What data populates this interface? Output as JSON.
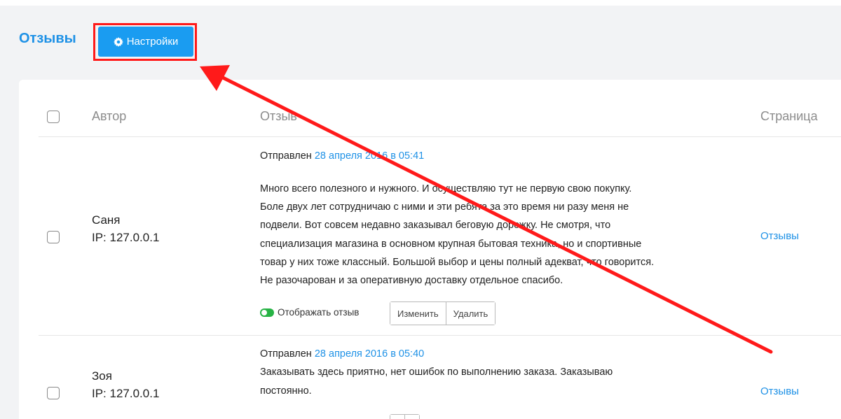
{
  "header": {
    "title": "Отзывы",
    "settings_label": "Настройки"
  },
  "table": {
    "columns": [
      "Автор",
      "Отзыв",
      "Страница"
    ]
  },
  "reviews": [
    {
      "author": "Саня",
      "ip": "IP: 127.0.0.1",
      "sent_label": "Отправлен",
      "date": "28 апреля 2016 в 05:41",
      "lines": [
        "Много всего полезного и нужного. И осуществляю тут не первую свою покупку.",
        "Боле двух лет сотрудничаю с ними и эти ребята за это время ни разу меня не",
        "подвели. Вот совсем недавно заказывал беговую дорожку. Не смотря, что",
        "специализация магазина в основном крупная бытовая техника, но и спортивные",
        "товар у них тоже классный. Большой выбор и цены полный адекват, что говорится.",
        "Не разочарован и за оперативную доставку отдельное спасибо."
      ],
      "toggle_label": "Отображать отзыв",
      "edit_label": "Изменить",
      "delete_label": "Удалить",
      "page_link": "Отзывы"
    },
    {
      "author": "Зоя",
      "ip": "IP: 127.0.0.1",
      "sent_label": "Отправлен",
      "date": "28 апреля 2016 в 05:40",
      "lines": [
        "Заказывать здесь приятно, нет ошибок по выполнению заказа. Заказываю",
        "постоянно."
      ],
      "page_link": "Отзывы"
    }
  ],
  "colors": {
    "accent": "#1e91e6",
    "button": "#1a9cf1",
    "annotation": "#ff1a1a",
    "toggle_on": "#27b345"
  }
}
